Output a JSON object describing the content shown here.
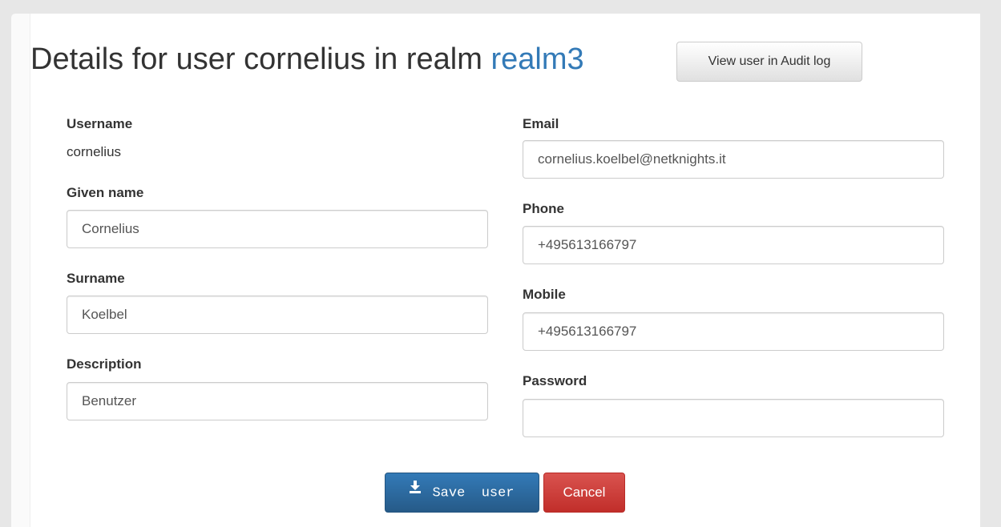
{
  "header": {
    "title_prefix": "Details for user cornelius in realm",
    "realm": "realm3",
    "audit_button_label": "View user in Audit log"
  },
  "form": {
    "username": {
      "label": "Username",
      "value": "cornelius"
    },
    "given_name": {
      "label": "Given name",
      "value": "Cornelius"
    },
    "surname": {
      "label": "Surname",
      "value": "Koelbel"
    },
    "description": {
      "label": "Description",
      "value": "Benutzer"
    },
    "email": {
      "label": "Email",
      "value": "cornelius.koelbel@netknights.it"
    },
    "phone": {
      "label": "Phone",
      "value": "+495613166797"
    },
    "mobile": {
      "label": "Mobile",
      "value": "+495613166797"
    },
    "password": {
      "label": "Password",
      "value": ""
    }
  },
  "actions": {
    "save_label": "Save  user",
    "save_icon": "download-icon",
    "cancel_label": "Cancel"
  },
  "colors": {
    "link": "#337ab7",
    "primary": "#337ab7",
    "danger": "#d9534f"
  }
}
